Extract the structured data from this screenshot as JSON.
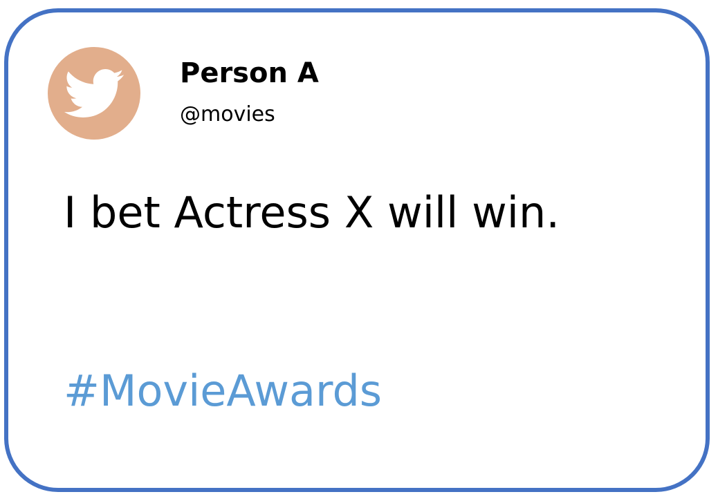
{
  "tweet": {
    "display_name": "Person A",
    "handle": "@movies",
    "text": "I bet Actress X will win.",
    "hashtag": "#MovieAwards"
  },
  "avatar": {
    "icon": "twitter-bird-icon",
    "background_color": "#e2ae8c",
    "icon_color": "#ffffff"
  },
  "colors": {
    "card_border": "#4472c4",
    "hashtag": "#5b9bd5",
    "text": "#000000"
  }
}
